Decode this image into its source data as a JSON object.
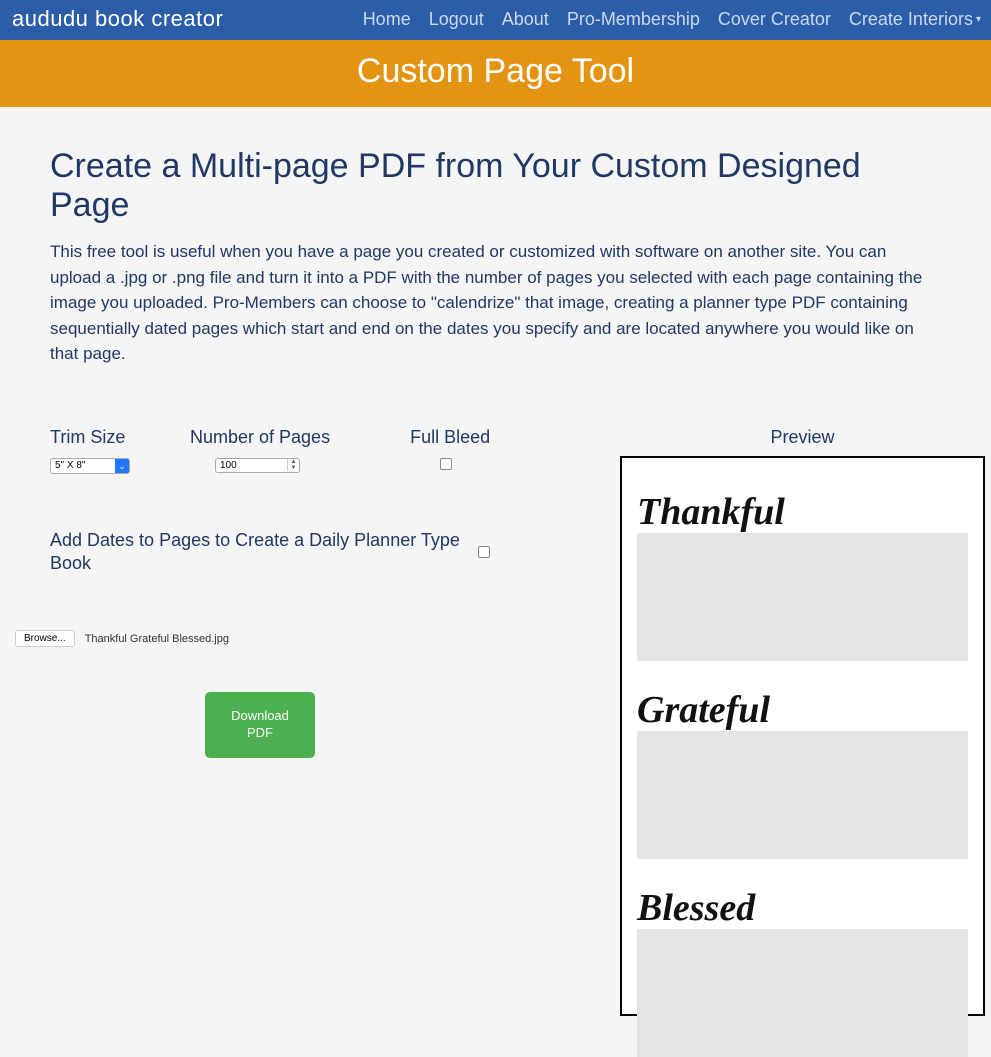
{
  "nav": {
    "brand": "aududu book creator",
    "links": {
      "home": "Home",
      "logout": "Logout",
      "about": "About",
      "pro": "Pro-Membership",
      "cover": "Cover Creator",
      "interiors": "Create Interiors"
    }
  },
  "banner": {
    "title": "Custom Page Tool"
  },
  "page": {
    "heading": "Create a Multi-page PDF from Your Custom Designed Page",
    "description": "This free tool is useful when you have a page you created or customized with software on another site.  You can upload a .jpg or .png file and turn it into  a PDF with the number of pages you selected with each page containing the image you uploaded.  Pro-Members can choose to \"calendrize\" that image, creating a planner type PDF containing  sequentially dated pages which start and end on the dates you specify and are located anywhere  you would like on that page."
  },
  "form": {
    "trim_size_label": "Trim Size",
    "trim_size_value": "5\" X 8\"",
    "num_pages_label": "Number of Pages",
    "num_pages_value": "100",
    "full_bleed_label": "Full Bleed",
    "add_dates_label": "Add Dates to Pages to Create a Daily Planner Type Book",
    "browse_label": "Browse...",
    "file_name": "Thankful Grateful Blessed.jpg",
    "download_label": "Download PDF"
  },
  "preview": {
    "label": "Preview",
    "sections": {
      "s1": "Thankful",
      "s2": "Grateful",
      "s3": "Blessed"
    }
  }
}
